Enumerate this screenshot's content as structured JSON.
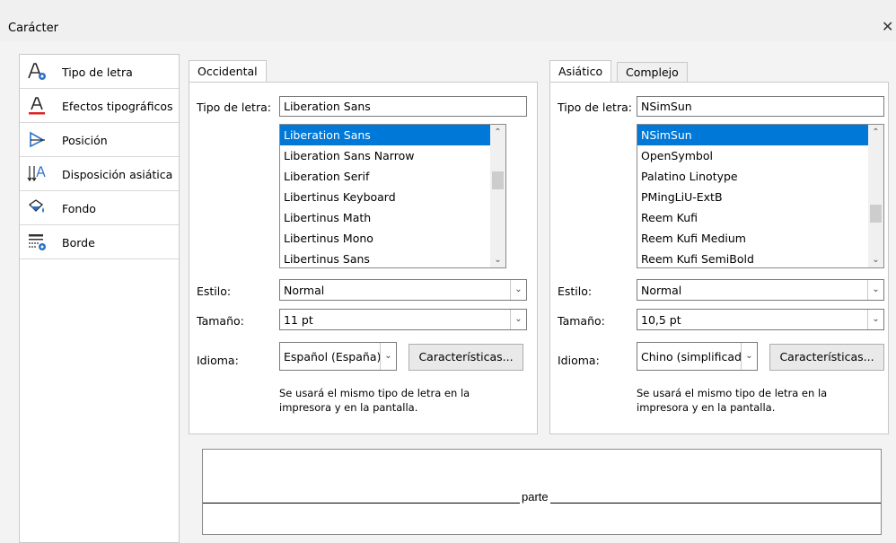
{
  "window": {
    "title": "Carácter",
    "close_glyph": "✕"
  },
  "sidebar": {
    "items": [
      {
        "label": "Tipo de letra",
        "icon": "font-icon"
      },
      {
        "label": "Efectos tipográficos",
        "icon": "font-effects-icon"
      },
      {
        "label": "Posición",
        "icon": "position-icon"
      },
      {
        "label": "Disposición asiática",
        "icon": "asian-layout-icon"
      },
      {
        "label": "Fondo",
        "icon": "background-icon"
      },
      {
        "label": "Borde",
        "icon": "border-icon"
      }
    ]
  },
  "western": {
    "tab": "Occidental",
    "font_label": "Tipo de letra:",
    "font_value": "Liberation Sans",
    "font_list": [
      "Liberation Sans",
      "Liberation Sans Narrow",
      "Liberation Serif",
      "Libertinus Keyboard",
      "Libertinus Math",
      "Libertinus Mono",
      "Libertinus Sans"
    ],
    "style_label": "Estilo:",
    "style_value": "Normal",
    "size_label": "Tamaño:",
    "size_value": "11 pt",
    "lang_label": "Idioma:",
    "lang_value": "Español (España)",
    "features_button": "Características...",
    "note": "Se usará el mismo tipo de letra en la impresora y en la pantalla."
  },
  "asian": {
    "tabs": [
      "Asiático",
      "Complejo"
    ],
    "font_label": "Tipo de letra:",
    "font_value": "NSimSun",
    "font_list": [
      "NSimSun",
      "OpenSymbol",
      "Palatino Linotype",
      "PMingLiU-ExtB",
      "Reem Kufi",
      "Reem Kufi Medium",
      "Reem Kufi SemiBold"
    ],
    "style_label": "Estilo:",
    "style_value": "Normal",
    "size_label": "Tamaño:",
    "size_value": "10,5 pt",
    "lang_label": "Idioma:",
    "lang_value": "Chino (simplificad",
    "features_button": "Características...",
    "note": "Se usará el mismo tipo de letra en la impresora y en la pantalla."
  },
  "preview": {
    "text": "parte"
  },
  "colors": {
    "selection": "#0078d7",
    "effects_underline": "#e02020",
    "icon_blue": "#2a72c9"
  }
}
